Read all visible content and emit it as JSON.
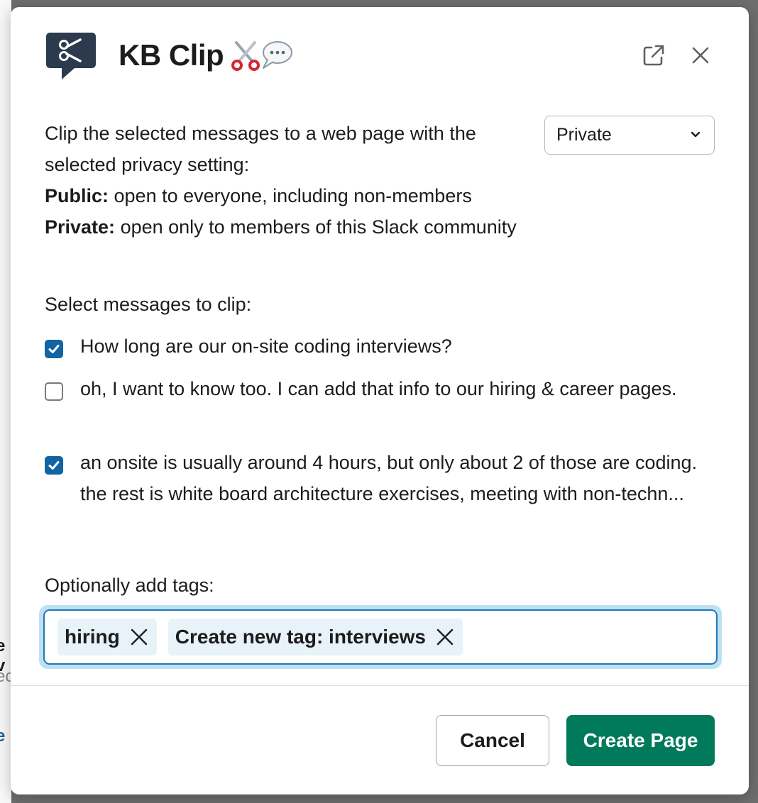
{
  "background": {
    "fragment_1": "e v",
    "fragment_2": "ec",
    "fragment_3": "e"
  },
  "dialog": {
    "title": "KB Clip",
    "title_emoji": [
      "scissors-icon",
      "speech-bubble-icon"
    ],
    "app_icon": "kb-clip-logo",
    "open_external_icon": "external-link-icon",
    "close_icon": "close-icon"
  },
  "description": {
    "line": "Clip the selected messages to a web page with the selected privacy setting:",
    "public_label": "Public:",
    "public_text": " open to everyone, including non-members",
    "private_label": "Private:",
    "private_text": " open only to members of this Slack community"
  },
  "privacy_select": {
    "value": "Private",
    "options": [
      "Private"
    ]
  },
  "messages": {
    "label": "Select messages to clip:",
    "items": [
      {
        "checked": true,
        "text": "How long are our on-site coding interviews?"
      },
      {
        "checked": false,
        "text": "oh, I want to know too.  I can add that info to our hiring & career pages."
      },
      {
        "checked": true,
        "text": "an onsite is usually around 4 hours, but only about 2 of those are coding.  the rest is white board architecture exercises, meeting with non-techn..."
      }
    ]
  },
  "tags": {
    "label": "Optionally add tags:",
    "items": [
      {
        "text": "hiring"
      },
      {
        "text": "Create new tag: interviews"
      }
    ]
  },
  "footer": {
    "cancel_label": "Cancel",
    "create_label": "Create Page"
  },
  "colors": {
    "primary_button": "#007a5a",
    "checkbox_checked": "#1264a3",
    "focus_ring": "#1d7ab8",
    "tag_bg": "#e8f2f9"
  }
}
